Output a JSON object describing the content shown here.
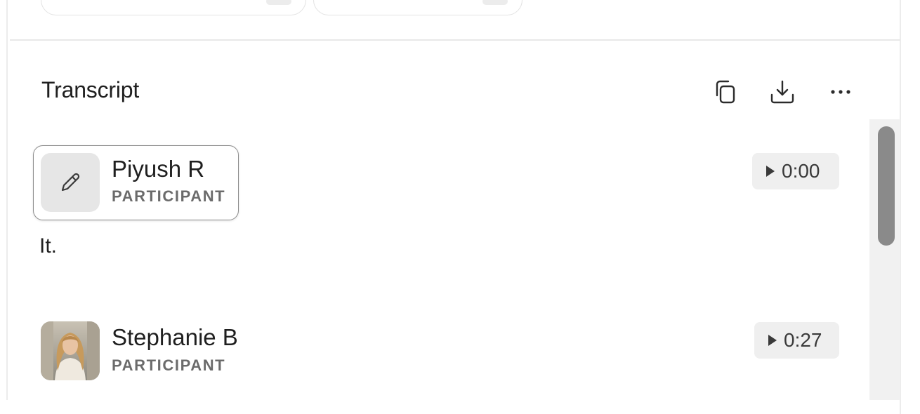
{
  "transcript": {
    "title": "Transcript",
    "actions": {
      "copy_icon": "copy-icon",
      "download_icon": "download-icon",
      "more_icon": "more-options-icon"
    },
    "entries": [
      {
        "speaker": "Piyush R",
        "role": "PARTICIPANT",
        "time": "0:00",
        "text": "It.",
        "avatar_icon": "pencil-icon",
        "selected": true
      },
      {
        "speaker": "Stephanie B",
        "role": "PARTICIPANT",
        "time": "0:27",
        "avatar_icon": "profile-photo"
      }
    ]
  },
  "colors": {
    "chip_border": "#8d8d8d",
    "time_button_bg": "#efefef",
    "scroll_thumb": "#8a8a8a",
    "role_text": "#6b6b6b"
  }
}
